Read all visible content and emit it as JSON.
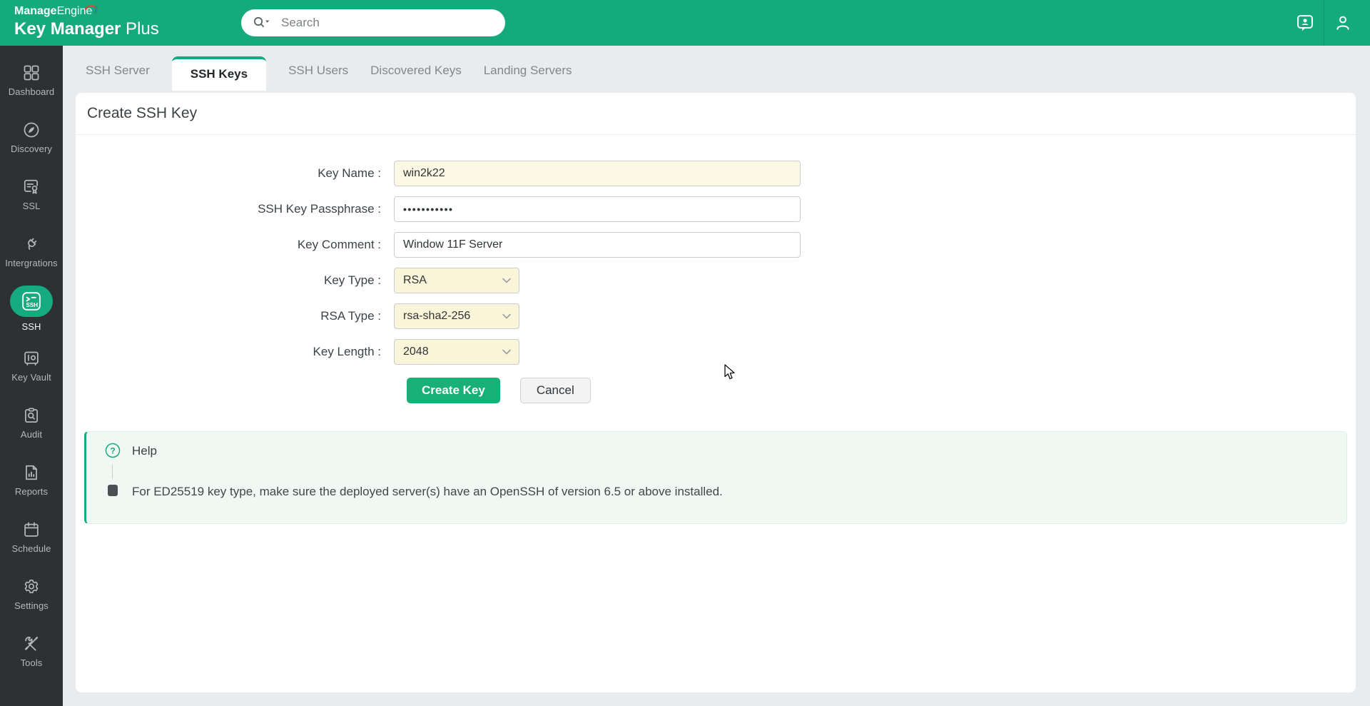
{
  "colors": {
    "header_green": "#14aa7c",
    "accent_green": "#16ab7e",
    "button_green": "#17b077",
    "input_highlight": "#fdf8e3",
    "select_bg": "#faf4d9",
    "sidebar_bg": "#2d3134",
    "help_bg": "#eff8f3"
  },
  "header": {
    "brand_top_bold": "Manage",
    "brand_top_light": "Engine",
    "brand_bottom_bold": "Key Manager",
    "brand_bottom_light": " Plus",
    "search_placeholder": "Search"
  },
  "sidebar": {
    "ssh_icon_text": "SSH",
    "items": [
      {
        "label": "Dashboard"
      },
      {
        "label": "Discovery"
      },
      {
        "label": "SSL"
      },
      {
        "label": "Intergrations"
      },
      {
        "label": "SSH",
        "active": true
      },
      {
        "label": "Key Vault"
      },
      {
        "label": "Audit"
      },
      {
        "label": "Reports"
      },
      {
        "label": "Schedule"
      },
      {
        "label": "Settings"
      },
      {
        "label": "Tools"
      }
    ]
  },
  "tabs": {
    "items": [
      "SSH Server",
      "SSH Keys",
      "SSH Users",
      "Discovered Keys",
      "Landing Servers"
    ],
    "active": "SSH Keys"
  },
  "page": {
    "title": "Create SSH Key"
  },
  "form": {
    "fields": [
      {
        "label": "Key Name :",
        "value": "win2k22"
      },
      {
        "label": "SSH Key Passphrase :",
        "value": "•••••••••••"
      },
      {
        "label": "Key Comment :",
        "value": "Window 11F Server"
      },
      {
        "label": "Key Type :",
        "value": "RSA"
      },
      {
        "label": "RSA Type :",
        "value": "rsa-sha2-256"
      },
      {
        "label": "Key Length :",
        "value": "2048"
      }
    ],
    "buttons": {
      "create": "Create Key",
      "cancel": "Cancel"
    }
  },
  "help": {
    "title": "Help",
    "text": "For ED25519 key type, make sure the deployed server(s) have an OpenSSH of version 6.5 or above installed."
  }
}
